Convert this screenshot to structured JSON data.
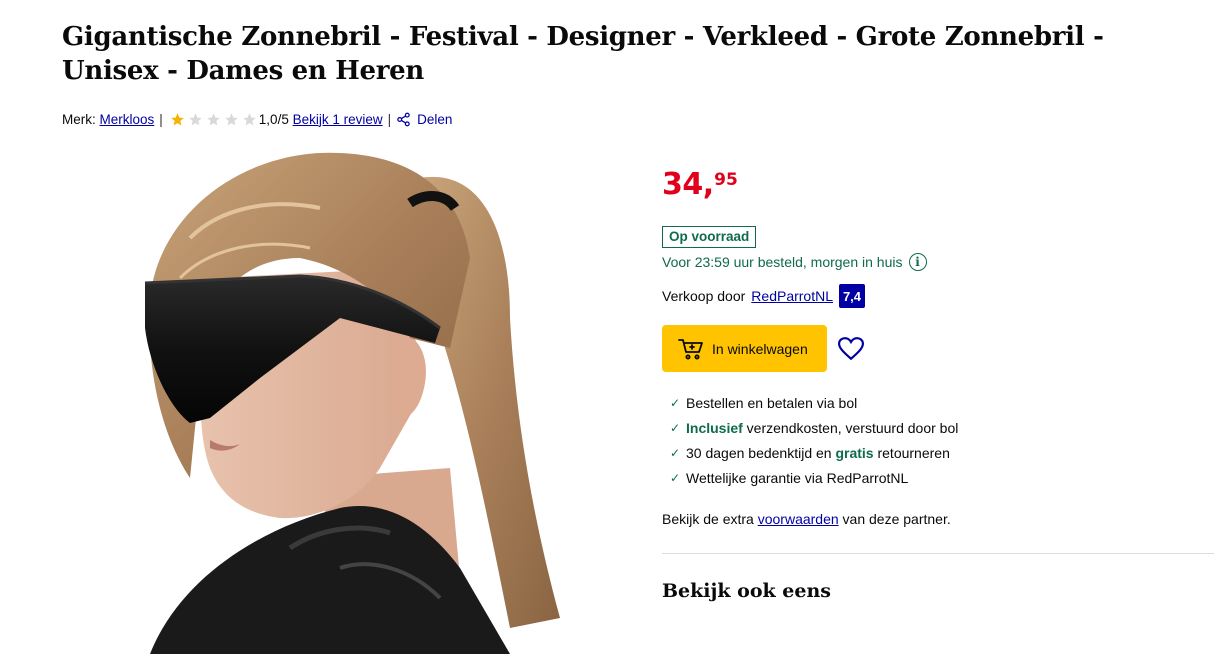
{
  "product": {
    "title": "Gigantische Zonnebril - Festival - Designer - Verkleed - Grote Zonnebril - Unisex - Dames en Heren",
    "brand_label": "Merk:",
    "brand": "Merkloos",
    "separator": "|",
    "rating": 1,
    "rating_max": 5,
    "rating_text": "1,0/5",
    "review_link": "Bekijk 1 review",
    "share_label": "Delen"
  },
  "offer": {
    "price_euros": "34",
    "price_comma": ",",
    "price_cents": "95",
    "stock_label": "Op voorraad",
    "delivery_text": "Voor 23:59 uur besteld, morgen in huis",
    "seller_label": "Verkoop door",
    "seller_name": "RedParrotNL",
    "seller_score": "7,4",
    "cart_button": "In winkelwagen"
  },
  "usps": {
    "u1": "Bestellen en betalen via bol",
    "u2_bold": "Inclusief",
    "u2_rest": " verzendkosten, verstuurd door bol",
    "u3_pre": "30 dagen bedenktijd en ",
    "u3_bold": "gratis",
    "u3_post": " retourneren",
    "u4": "Wettelijke garantie via RedParrotNL"
  },
  "terms": {
    "pre": "Bekijk de extra ",
    "link": "voorwaarden",
    "post": " van deze partner."
  },
  "see_also_title": "Bekijk ook eens",
  "colors": {
    "price": "#e0001b",
    "link": "#0000a4",
    "green": "#0f6b4a",
    "cart_button": "#ffc300",
    "star_filled": "#f5b301",
    "star_empty": "#d9d9d9"
  }
}
